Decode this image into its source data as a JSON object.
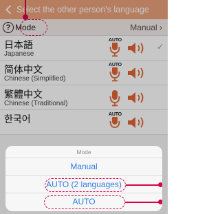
{
  "header": {
    "back_icon": "chevron-left-icon",
    "title": "Select the other person's language"
  },
  "mode_bar": {
    "help_icon_glyph": "?",
    "label": "Mode",
    "value": "Manual",
    "value_chevron": "chevron-right-icon"
  },
  "languages": [
    {
      "name": "日本語",
      "subtitle": "Japanese",
      "mic_auto": true,
      "selected": true
    },
    {
      "name": "简体中文",
      "subtitle": "Chinese (Simplified)",
      "mic_auto": true,
      "selected": false
    },
    {
      "name": "繁體中文",
      "subtitle": "Chinese (Traditional)",
      "mic_auto": false,
      "selected": false
    },
    {
      "name": "한국어",
      "subtitle": "",
      "mic_auto": true,
      "selected": false
    }
  ],
  "auto_tag": "AUTO",
  "check_mark": "✓",
  "sheet": {
    "title": "Mode",
    "options": [
      "Manual",
      "AUTO (2 languages)",
      "AUTO"
    ]
  },
  "colors": {
    "header": "#e9a07a",
    "mic": "#e06432",
    "speaker": "#e06432",
    "annotation": "#d6004e",
    "option_text": "#2f7de1"
  }
}
